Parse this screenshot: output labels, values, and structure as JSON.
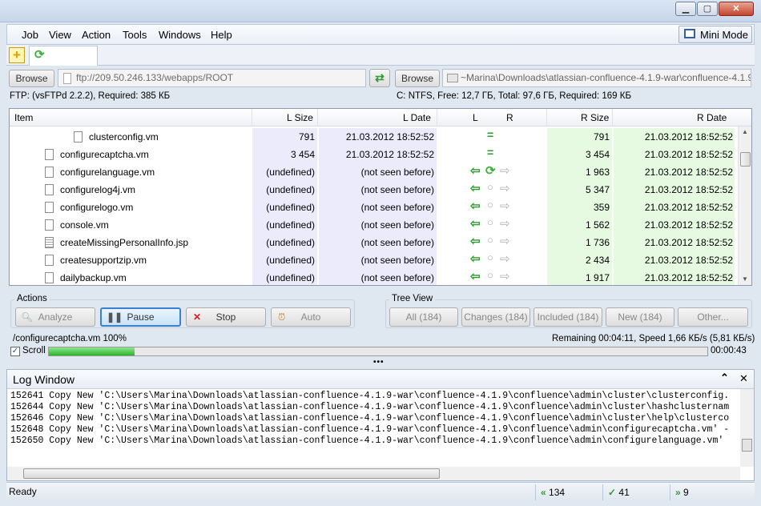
{
  "menu": {
    "items": [
      "Job",
      "View",
      "Action",
      "Tools",
      "Windows",
      "Help"
    ],
    "mini_mode": "Mini Mode"
  },
  "paths": {
    "browse_left": "Browse",
    "left_path": "ftp://209.50.246.133/webapps/ROOT",
    "browse_right": "Browse",
    "right_path": "~Marina\\Downloads\\atlassian-confluence-4.1.9-war\\confluence-4.1.9\\con",
    "left_info": "FTP: (vsFTPd 2.2.2), Required: 385 КБ",
    "right_info": "C: NTFS, Free: 12,7 ГБ, Total: 97,6 ГБ, Required: 169 КБ"
  },
  "table": {
    "headers": {
      "item": "Item",
      "lsize": "L Size",
      "ldate": "L Date",
      "l": "L",
      "r": "R",
      "rsize": "R Size",
      "rdate": "R Date"
    },
    "rows": [
      {
        "name": "clusterconfig.vm",
        "lsize": "791",
        "ldate": "21.03.2012 18:52:52",
        "status": "equal",
        "rsize": "791",
        "rdate": "21.03.2012 18:52:52"
      },
      {
        "name": "configurecaptcha.vm",
        "lsize": "3 454",
        "ldate": "21.03.2012 18:52:52",
        "status": "equal",
        "rsize": "3 454",
        "rdate": "21.03.2012 18:52:52"
      },
      {
        "name": "configurelanguage.vm",
        "lsize": "(undefined)",
        "ldate": "(not seen before)",
        "status": "copy-sync",
        "rsize": "1 963",
        "rdate": "21.03.2012 18:52:52"
      },
      {
        "name": "configurelog4j.vm",
        "lsize": "(undefined)",
        "ldate": "(not seen before)",
        "status": "copy",
        "rsize": "5 347",
        "rdate": "21.03.2012 18:52:52"
      },
      {
        "name": "configurelogo.vm",
        "lsize": "(undefined)",
        "ldate": "(not seen before)",
        "status": "copy",
        "rsize": "359",
        "rdate": "21.03.2012 18:52:52"
      },
      {
        "name": "console.vm",
        "lsize": "(undefined)",
        "ldate": "(not seen before)",
        "status": "copy",
        "rsize": "1 562",
        "rdate": "21.03.2012 18:52:52"
      },
      {
        "name": "createMissingPersonalInfo.jsp",
        "lsize": "(undefined)",
        "ldate": "(not seen before)",
        "status": "copy",
        "rsize": "1 736",
        "rdate": "21.03.2012 18:52:52"
      },
      {
        "name": "createsupportzip.vm",
        "lsize": "(undefined)",
        "ldate": "(not seen before)",
        "status": "copy",
        "rsize": "2 434",
        "rdate": "21.03.2012 18:52:52"
      },
      {
        "name": "dailybackup.vm",
        "lsize": "(undefined)",
        "ldate": "(not seen before)",
        "status": "copy",
        "rsize": "1 917",
        "rdate": "21.03.2012 18:52:52"
      }
    ]
  },
  "actions": {
    "label": "Actions",
    "analyze": "Analyze",
    "pause": "Pause",
    "stop": "Stop",
    "auto": "Auto"
  },
  "tree_view": {
    "label": "Tree View",
    "all": "All (184)",
    "changes": "Changes (184)",
    "included": "Included (184)",
    "new": "New (184)",
    "other": "Other..."
  },
  "progress": {
    "current_file": "/configurecaptcha.vm 100%",
    "remaining": "Remaining 00:04:11, Speed 1,66 КБ/s (5,81 КБ/s)",
    "scroll_label": "Scroll",
    "scroll_checked": true,
    "fraction": 0.13,
    "elapsed": "00:00:43"
  },
  "log": {
    "title": "Log Window",
    "lines": [
      "152641 Copy New 'C:\\Users\\Marina\\Downloads\\atlassian-confluence-4.1.9-war\\confluence-4.1.9\\confluence\\admin\\cluster\\clusterconfig.",
      "152644 Copy New 'C:\\Users\\Marina\\Downloads\\atlassian-confluence-4.1.9-war\\confluence-4.1.9\\confluence\\admin\\cluster\\hashclusternam",
      "152646 Copy New 'C:\\Users\\Marina\\Downloads\\atlassian-confluence-4.1.9-war\\confluence-4.1.9\\confluence\\admin\\cluster\\help\\clusterco",
      "152648 Copy New 'C:\\Users\\Marina\\Downloads\\atlassian-confluence-4.1.9-war\\confluence-4.1.9\\confluence\\admin\\configurecaptcha.vm' -",
      "152650 Copy New 'C:\\Users\\Marina\\Downloads\\atlassian-confluence-4.1.9-war\\confluence-4.1.9\\confluence\\admin\\configurelanguage.vm'"
    ]
  },
  "status": {
    "text": "Ready",
    "left_count": "134",
    "ok_count": "41",
    "right_count": "9"
  },
  "colors": {
    "left_column_bg": "#ebebfc",
    "right_column_bg": "#e6f9e1",
    "arrow_green": "#2f9a2f",
    "progress_green": "#2bb52b"
  }
}
